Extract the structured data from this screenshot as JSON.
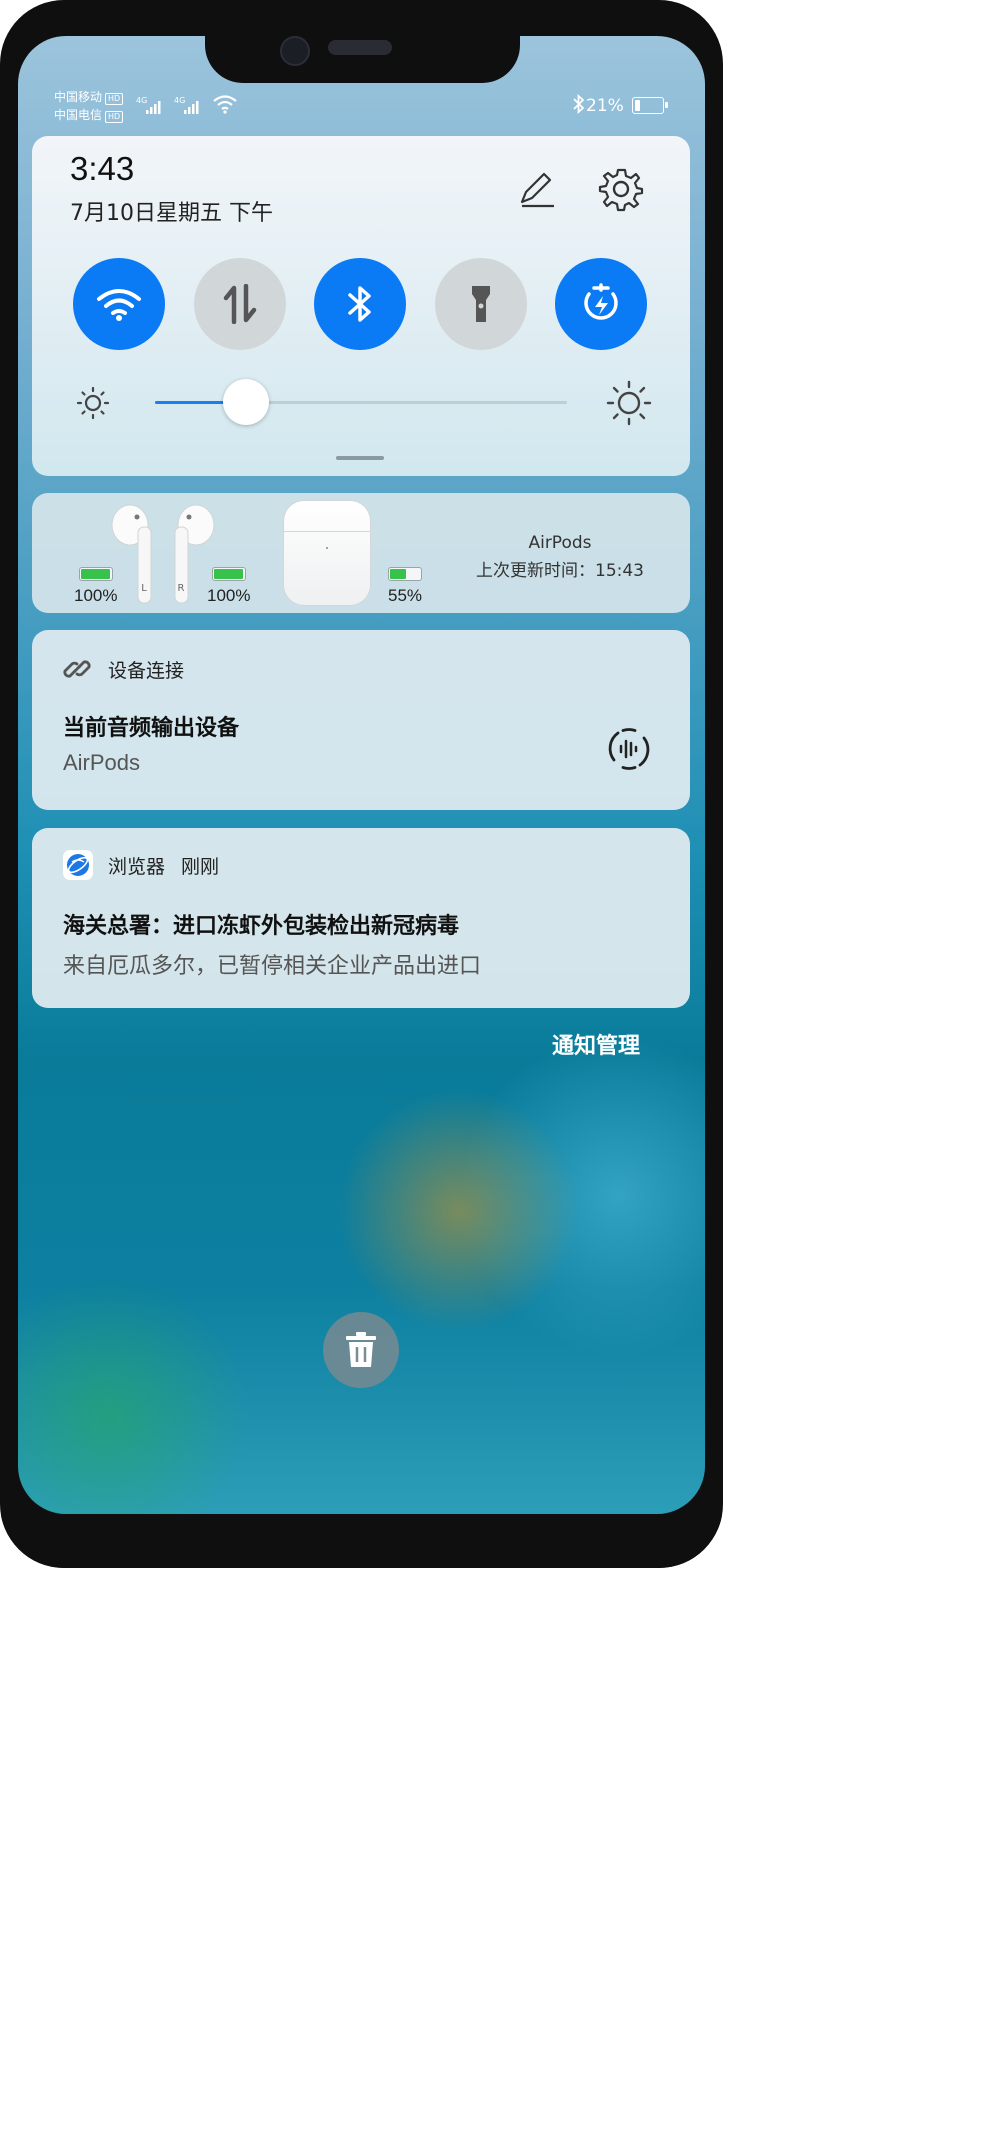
{
  "status_bar": {
    "carrier_1": "中国移动",
    "carrier_2": "中国电信",
    "hd_badge": "HD",
    "network_1": "4G",
    "network_2": "4G",
    "battery_text": "21%",
    "battery_level": 0.21
  },
  "quick_settings": {
    "time": "3:43",
    "date": "7月10日星期五 下午",
    "toggles": [
      {
        "icon": "wifi-icon",
        "state": "on"
      },
      {
        "icon": "mobile-data-icon",
        "state": "off"
      },
      {
        "icon": "bluetooth-icon",
        "state": "on"
      },
      {
        "icon": "flashlight-icon",
        "state": "off"
      },
      {
        "icon": "huawei-share-icon",
        "state": "on"
      }
    ],
    "brightness_level": 0.22
  },
  "airpods_card": {
    "left_percent": "100%",
    "left_level": 1.0,
    "left_label": "L",
    "right_percent": "100%",
    "right_level": 1.0,
    "right_label": "R",
    "case_percent": "55%",
    "case_level": 0.55,
    "name": "AirPods",
    "last_update": "上次更新时间：15:43"
  },
  "device_connection": {
    "header": "设备连接",
    "title": "当前音频输出设备",
    "device": "AirPods"
  },
  "browser_notification": {
    "app_name": "浏览器",
    "time": "刚刚",
    "title": "海关总署：进口冻虾外包装检出新冠病毒",
    "body": "来自厄瓜多尔，已暂停相关企业产品出进口"
  },
  "notification_management": "通知管理",
  "colors": {
    "accent": "#0a7bf5",
    "toggle_off": "#d1d6d9",
    "battery_green": "#37c24b"
  }
}
